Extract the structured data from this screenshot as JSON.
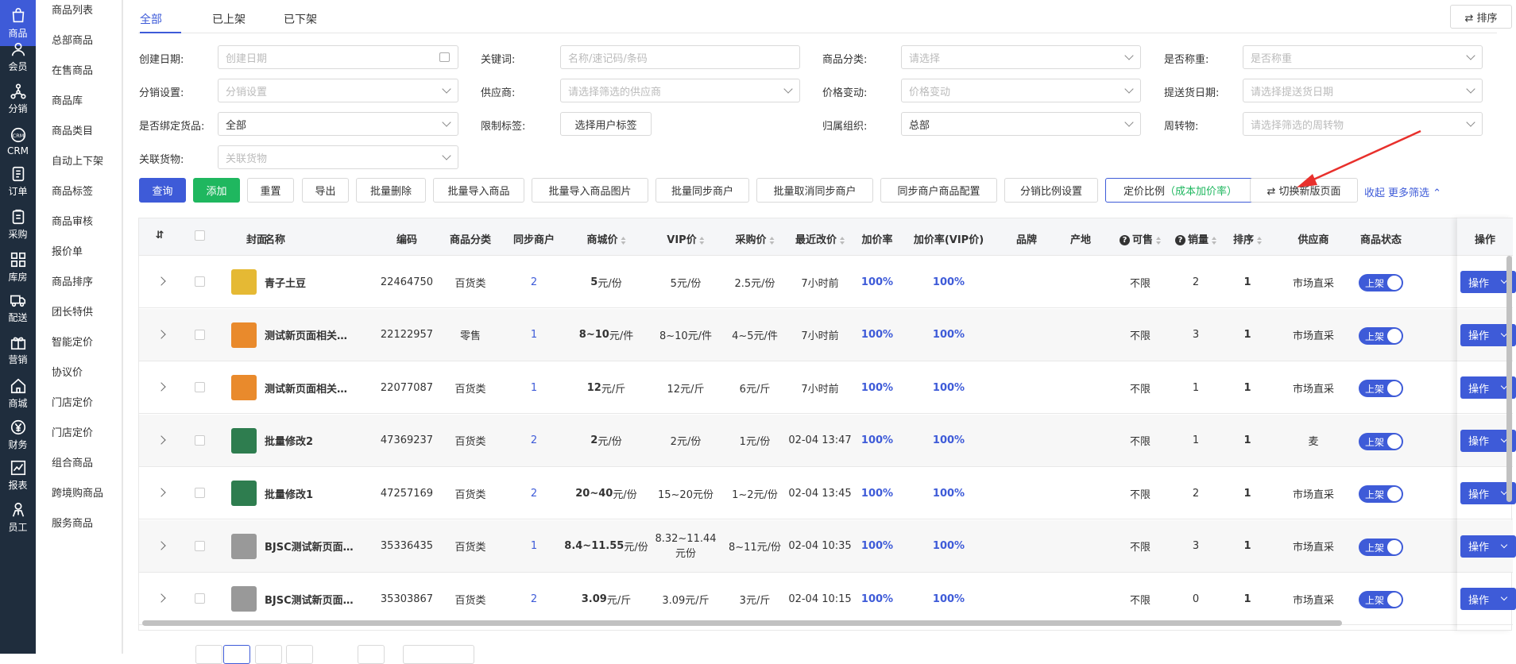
{
  "rail": [
    {
      "label": "商品",
      "icon": "bag-icon",
      "active": true
    },
    {
      "label": "会员",
      "icon": "user-icon"
    },
    {
      "label": "分销",
      "icon": "network-icon"
    },
    {
      "label": "CRM",
      "icon": "crm-icon"
    },
    {
      "label": "订单",
      "icon": "order-icon"
    },
    {
      "label": "采购",
      "icon": "clipboard-icon"
    },
    {
      "label": "库房",
      "icon": "grid-icon"
    },
    {
      "label": "配送",
      "icon": "truck-icon"
    },
    {
      "label": "营销",
      "icon": "gift-icon"
    },
    {
      "label": "商城",
      "icon": "home-icon"
    },
    {
      "label": "财务",
      "icon": "yen-icon"
    },
    {
      "label": "报表",
      "icon": "chart-icon"
    },
    {
      "label": "员工",
      "icon": "staff-icon"
    }
  ],
  "subnav": [
    "商品列表",
    "总部商品",
    "在售商品",
    "商品库",
    "商品类目",
    "自动上下架",
    "商品标签",
    "商品审核",
    "报价单",
    "商品排序",
    "团长特供",
    "智能定价",
    "协议价",
    "门店定价",
    "门店定价",
    "组合商品",
    "跨境购商品",
    "服务商品"
  ],
  "tabs": [
    "全部",
    "已上架",
    "已下架"
  ],
  "sort_button": "⇄ 排序",
  "filters": {
    "create_date": {
      "label": "创建日期:",
      "placeholder": "创建日期"
    },
    "keyword": {
      "label": "关键词:",
      "placeholder": "名称/速记码/条码"
    },
    "category": {
      "label": "商品分类:",
      "placeholder": "请选择"
    },
    "weighing": {
      "label": "是否称重:",
      "placeholder": "是否称重"
    },
    "distribution": {
      "label": "分销设置:",
      "placeholder": "分销设置"
    },
    "supplier": {
      "label": "供应商:",
      "placeholder": "请选择筛选的供应商"
    },
    "price_change": {
      "label": "价格变动:",
      "placeholder": "价格变动"
    },
    "delivery_date": {
      "label": "提送货日期:",
      "placeholder": "请选择提送货日期"
    },
    "bind_goods": {
      "label": "是否绑定货品:",
      "value": "全部"
    },
    "limit_tag": {
      "label": "限制标签:",
      "button": "选择用户标签"
    },
    "org": {
      "label": "归属组织:",
      "value": "总部"
    },
    "turnover": {
      "label": "周转物:",
      "placeholder": "请选择筛选的周转物"
    },
    "related_goods": {
      "label": "关联货物:",
      "placeholder": "关联货物"
    }
  },
  "actions": {
    "query": "查询",
    "add": "添加",
    "reset": "重置",
    "export": "导出",
    "batch_delete": "批量删除",
    "batch_import": "批量导入商品",
    "batch_import_img": "批量导入商品图片",
    "batch_sync": "批量同步商户",
    "batch_cancel_sync": "批量取消同步商户",
    "sync_config": "同步商户商品配置",
    "dist_ratio": "分销比例设置",
    "pricing_ratio": "定价比例（成本加价率）",
    "switch_new": "⇄ 切换新版页面",
    "collapse": "收起",
    "more_filters": "更多筛选 ⌃"
  },
  "columns": [
    "封面",
    "名称",
    "编码",
    "商品分类",
    "同步商户",
    "商城价",
    "VIP价",
    "采购价",
    "最近改价",
    "加价率",
    "加价率(VIP价)",
    "品牌",
    "产地",
    "可售",
    "销量",
    "排序",
    "供应商",
    "商品状态",
    "操作"
  ],
  "rows": [
    {
      "name": "青子土豆",
      "code": "22464750",
      "category": "百货类",
      "sync": "2",
      "mall_price_num": "5",
      "mall_price_unit": " 元/份",
      "vip": "5元/份",
      "purchase": "2.5元/份",
      "last_change": "7小时前",
      "markup": "100%",
      "markup_vip": "100%",
      "available": "不限",
      "sales": "2",
      "sort": "1",
      "supplier": "市场直采",
      "status": "上架",
      "op": "操作",
      "thumb": "#e5b934"
    },
    {
      "name": "测试新页面相关…",
      "code": "22122957",
      "category": "零售",
      "sync": "1",
      "mall_price_num": "8~10",
      "mall_price_unit": " 元/件",
      "vip": "8~10元/件",
      "purchase": "4~5元/件",
      "last_change": "7小时前",
      "markup": "100%",
      "markup_vip": "100%",
      "available": "不限",
      "sales": "3",
      "sort": "1",
      "supplier": "市场直采",
      "status": "上架",
      "op": "操作",
      "thumb": "#e98a2c"
    },
    {
      "name": "测试新页面相关…",
      "code": "22077087",
      "category": "百货类",
      "sync": "1",
      "mall_price_num": "12",
      "mall_price_unit": " 元/斤",
      "vip": "12元/斤",
      "purchase": "6元/斤",
      "last_change": "7小时前",
      "markup": "100%",
      "markup_vip": "100%",
      "available": "不限",
      "sales": "1",
      "sort": "1",
      "supplier": "市场直采",
      "status": "上架",
      "op": "操作",
      "thumb": "#e98a2c"
    },
    {
      "name": "批量修改2",
      "code": "47369237",
      "category": "百货类",
      "sync": "2",
      "mall_price_num": "2",
      "mall_price_unit": " 元/份",
      "vip": "2元/份",
      "purchase": "1元/份",
      "last_change": "02-04 13:47",
      "markup": "100%",
      "markup_vip": "100%",
      "available": "不限",
      "sales": "1",
      "sort": "1",
      "supplier": "麦",
      "status": "上架",
      "op": "操作",
      "thumb": "#2e7d4f"
    },
    {
      "name": "批量修改1",
      "code": "47257169",
      "category": "百货类",
      "sync": "2",
      "mall_price_num": "20~40",
      "mall_price_unit": " 元/份",
      "vip": "15~20元份",
      "purchase": "1~2元/份",
      "last_change": "02-04 13:45",
      "markup": "100%",
      "markup_vip": "100%",
      "available": "不限",
      "sales": "2",
      "sort": "1",
      "supplier": "市场直采",
      "status": "上架",
      "op": "操作",
      "thumb": "#2e7d4f"
    },
    {
      "name": "BJSC测试新页面…",
      "code": "35336435",
      "category": "百货类",
      "sync": "1",
      "mall_price_num": "8.4~11.55",
      "mall_price_unit": " 元/份",
      "vip": "8.32~11.44元份",
      "purchase": "8~11元/份",
      "last_change": "02-04 10:35",
      "markup": "100%",
      "markup_vip": "100%",
      "available": "不限",
      "sales": "3",
      "sort": "1",
      "supplier": "市场直采",
      "status": "上架",
      "op": "操作",
      "thumb": "#999999"
    },
    {
      "name": "BJSC测试新页面…",
      "code": "35303867",
      "category": "百货类",
      "sync": "2",
      "mall_price_num": "3.09",
      "mall_price_unit": " 元/斤",
      "vip": "3.09元/斤",
      "purchase": "3元/斤",
      "last_change": "02-04 10:15",
      "markup": "100%",
      "markup_vip": "100%",
      "available": "不限",
      "sales": "0",
      "sort": "1",
      "supplier": "市场直采",
      "status": "上架",
      "op": "操作",
      "thumb": "#999999"
    }
  ],
  "colors": {
    "primary": "#3e5bd8",
    "success": "#1fb75f",
    "rail": "#1f2d3d",
    "annotation_arrow": "#e8302c"
  }
}
